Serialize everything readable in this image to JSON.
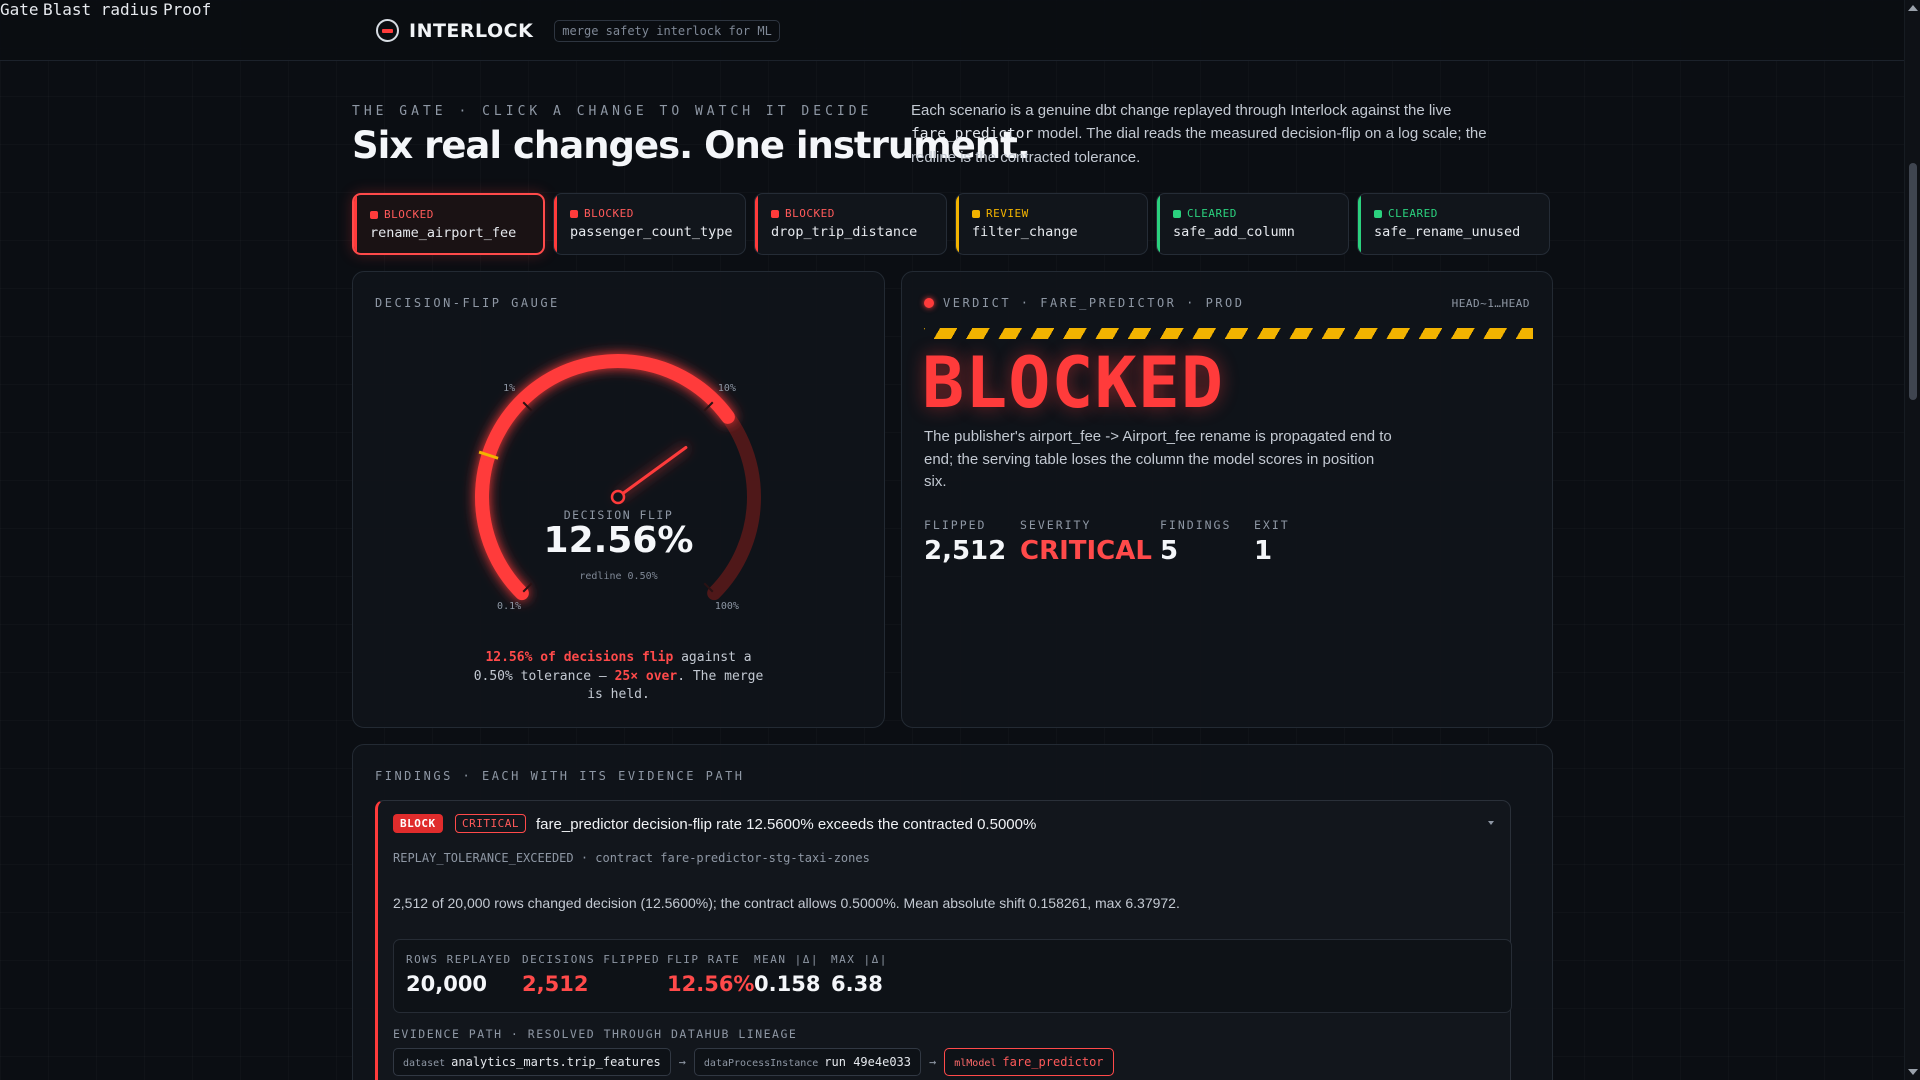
{
  "header": {
    "brand": "INTERLOCK",
    "tagline": "merge safety interlock for ML",
    "nav": [
      "Gate",
      "Blast radius",
      "Proof"
    ]
  },
  "hero": {
    "eyebrow": "THE GATE · CLICK A CHANGE TO WATCH IT DECIDE",
    "title": "Six real changes. One instrument.",
    "desc_1": "Each scenario is a genuine dbt change replayed through Interlock against the live",
    "desc_code": "fare_predictor",
    "desc_2": "model. The dial reads the measured decision-flip on a log scale; the redline is the contracted tolerance."
  },
  "scenarios": [
    {
      "status": "BLOCKED",
      "name": "rename_airport_fee",
      "kind": "blocked",
      "active": true
    },
    {
      "status": "BLOCKED",
      "name": "passenger_count_type",
      "kind": "blocked",
      "active": false
    },
    {
      "status": "BLOCKED",
      "name": "drop_trip_distance",
      "kind": "blocked",
      "active": false
    },
    {
      "status": "REVIEW",
      "name": "filter_change",
      "kind": "review",
      "active": false
    },
    {
      "status": "CLEARED",
      "name": "safe_add_column",
      "kind": "cleared",
      "active": false
    },
    {
      "status": "CLEARED",
      "name": "safe_rename_unused",
      "kind": "cleared",
      "active": false
    }
  ],
  "gauge": {
    "label": "DECISION-FLIP GAUGE",
    "center_label": "DECISION FLIP",
    "value_text": "12.56%",
    "value": 12.56,
    "redline_text": "redline 0.50%",
    "redline": 0.5,
    "ticks": [
      "0.1%",
      "1%",
      "10%",
      "100%"
    ],
    "caption_strong_1": "12.56% of decisions flip",
    "caption_mid": " against a 0.50% tolerance — ",
    "caption_strong_2": "25× over",
    "caption_end": ". The merge is held.",
    "colors": {
      "arc": "#ff3b3b",
      "redline": "#f2b300",
      "track": "#5a1a1a"
    }
  },
  "verdict": {
    "label": "VERDICT · FARE_PREDICTOR · PROD",
    "ref": "HEAD~1…HEAD",
    "word": "BLOCKED",
    "text": "The publisher's airport_fee -> Airport_fee rename is propagated end to end; the serving table loses the column the model scores in position six.",
    "stats": [
      {
        "label": "FLIPPED",
        "value": "2,512"
      },
      {
        "label": "SEVERITY",
        "value": "CRITICAL"
      },
      {
        "label": "FINDINGS",
        "value": "5"
      },
      {
        "label": "EXIT",
        "value": "1"
      }
    ]
  },
  "findings": {
    "label": "FINDINGS · EACH WITH ITS EVIDENCE PATH",
    "item": {
      "badge": "BLOCK",
      "severity": "CRITICAL",
      "title": "fare_predictor decision-flip rate 12.5600% exceeds the contracted 0.5000%",
      "code": "REPLAY_TOLERANCE_EXCEEDED · contract fare-predictor-stg-taxi-zones",
      "desc": "2,512 of 20,000 rows changed decision (12.5600%); the contract allows 0.5000%. Mean absolute shift 0.158261, max 6.37972.",
      "metrics": [
        {
          "label": "ROWS REPLAYED",
          "value": "20,000"
        },
        {
          "label": "DECISIONS FLIPPED",
          "value": "2,512"
        },
        {
          "label": "FLIP RATE",
          "value": "12.56%"
        },
        {
          "label": "MEAN |Δ|",
          "value": "0.158"
        },
        {
          "label": "MAX |Δ|",
          "value": "6.38"
        }
      ],
      "evidence_label": "EVIDENCE PATH · RESOLVED THROUGH DATAHUB LINEAGE",
      "evidence": [
        {
          "kind": "dataset",
          "name": "analytics_marts.trip_features"
        },
        {
          "kind": "dataProcessInstance",
          "name": "run 49e4e033"
        },
        {
          "kind": "mlModel",
          "name": "fare_predictor"
        }
      ]
    }
  }
}
